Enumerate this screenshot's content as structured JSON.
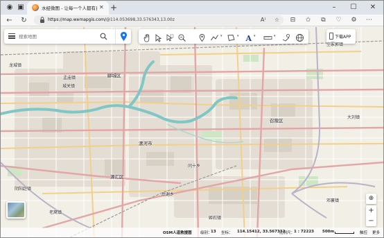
{
  "browser": {
    "tab_title": "水经微图 - 让每一个人都有自己...",
    "url_host": "https://map.wemapgis.com/",
    "url_rest": "@114.053698,33.576343,13.00z"
  },
  "map": {
    "search_placeholder": "搜索地图",
    "download_label": "下载APP",
    "districts": [
      {
        "name": "郾城区"
      },
      {
        "name": "召陵区"
      },
      {
        "name": "漯河市"
      },
      {
        "name": "源汇区"
      }
    ],
    "places": [
      "孟庙镇",
      "城关镇",
      "龙城镇",
      "后谢乡",
      "空冢郭镇",
      "阴阳赵镇",
      "问十乡",
      "大刘镇",
      "老窝镇",
      "姬石镇",
      "邓襄镇"
    ],
    "status": {
      "source": "OSM人道救援图",
      "level_label": "级别：",
      "level": "13",
      "coord_label": "坐标：",
      "coords": "114.15412, 33.567332",
      "scale_label": "比例尺：",
      "scale": "1 : 72223",
      "scale_bar": "500m",
      "mode": "触控",
      "more": "更多"
    }
  },
  "colors": {
    "road_major": "#e3a5a5",
    "road_secondary": "#f2d08a",
    "river": "#7fc7c4",
    "land": "#f2efe6",
    "accent": "#1a73e8"
  }
}
